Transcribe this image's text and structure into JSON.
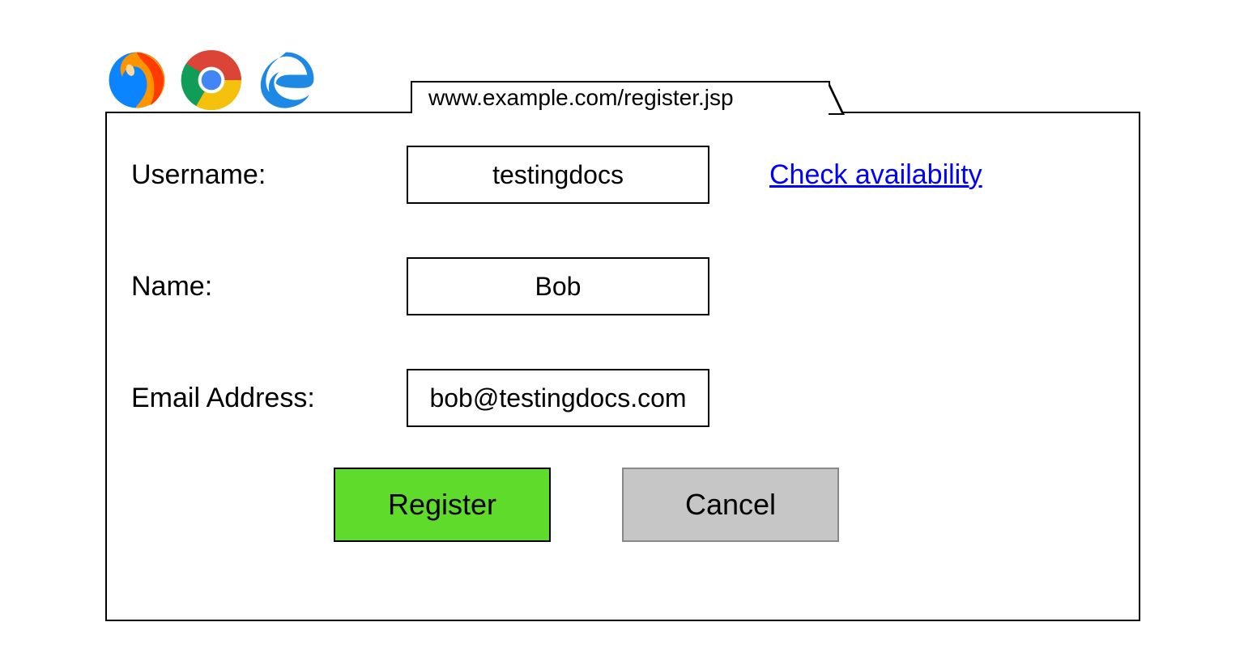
{
  "tab_url": "www.example.com/register.jsp",
  "form": {
    "username_label": "Username:",
    "username_value": "testingdocs",
    "check_link": "Check availability",
    "name_label": "Name:",
    "name_value": "Bob",
    "email_label": "Email Address:",
    "email_value": "bob@testingdocs.com"
  },
  "buttons": {
    "register": "Register",
    "cancel": "Cancel"
  }
}
